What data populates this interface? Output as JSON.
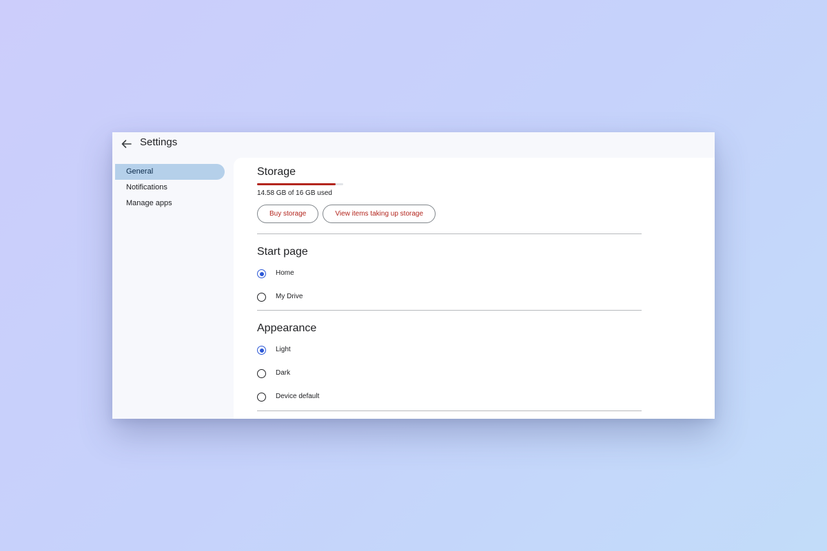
{
  "window": {
    "title": "Settings"
  },
  "sidebar": {
    "items": [
      {
        "label": "General",
        "active": true
      },
      {
        "label": "Notifications",
        "active": false
      },
      {
        "label": "Manage apps",
        "active": false
      }
    ]
  },
  "storage": {
    "title": "Storage",
    "usage_text": "14.58 GB of 16 GB used",
    "used_gb": 14.58,
    "total_gb": 16,
    "buy_label": "Buy storage",
    "view_label": "View items taking up storage"
  },
  "start_page": {
    "title": "Start page",
    "options": [
      {
        "label": "Home",
        "checked": true
      },
      {
        "label": "My Drive",
        "checked": false
      }
    ]
  },
  "appearance": {
    "title": "Appearance",
    "options": [
      {
        "label": "Light",
        "checked": true
      },
      {
        "label": "Dark",
        "checked": false
      },
      {
        "label": "Device default",
        "checked": false
      }
    ]
  },
  "colors": {
    "accent_red": "#b3261e",
    "radio_blue": "#2b57d6",
    "nav_active": "#b5d0ea"
  }
}
